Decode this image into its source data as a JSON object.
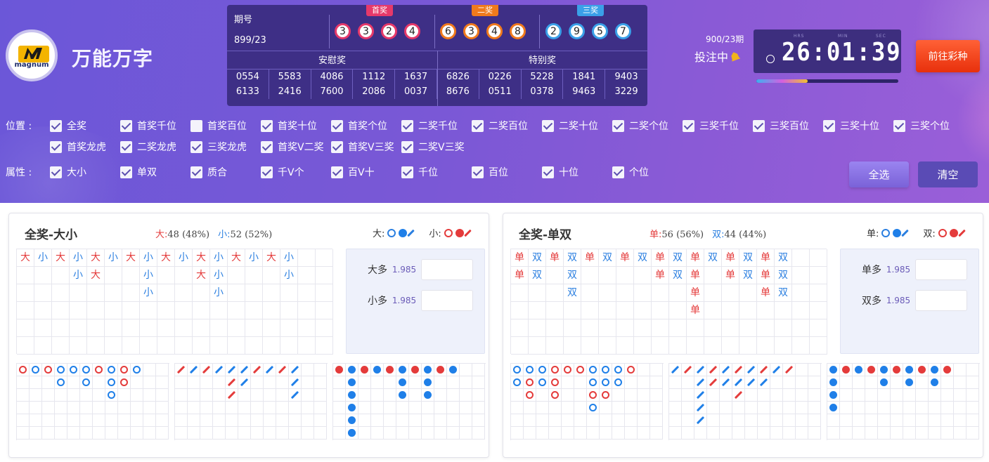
{
  "brand": {
    "logo_text": "magnum",
    "name": "万能万字"
  },
  "results": {
    "period_label": "期号",
    "period": "899/23",
    "prize1": {
      "label": "首奖",
      "numbers": [
        "3",
        "3",
        "2",
        "4"
      ]
    },
    "prize2": {
      "label": "二奖",
      "numbers": [
        "6",
        "3",
        "4",
        "8"
      ]
    },
    "prize3": {
      "label": "三奖",
      "numbers": [
        "2",
        "9",
        "5",
        "7"
      ]
    },
    "consolation_label": "安慰奖",
    "special_label": "特别奖",
    "rows": [
      [
        "0554",
        "5583",
        "4086",
        "1112",
        "1637",
        "6826",
        "0226",
        "5228",
        "1841",
        "9403"
      ],
      [
        "6133",
        "2416",
        "7600",
        "2086",
        "0037",
        "8676",
        "0511",
        "0378",
        "9463",
        "3229"
      ]
    ]
  },
  "countdown": {
    "next_period": "900/23期",
    "status": "投注中",
    "units": [
      "HRS",
      "MIN",
      "SEC"
    ],
    "time": "26:01:39",
    "progress": 0.36
  },
  "goto_button": "前往彩种",
  "filters": {
    "position_label": "位置 :",
    "positions": [
      {
        "label": "全奖",
        "checked": true
      },
      {
        "label": "首奖千位",
        "checked": true
      },
      {
        "label": "首奖百位",
        "checked": false
      },
      {
        "label": "首奖十位",
        "checked": true
      },
      {
        "label": "首奖个位",
        "checked": true
      },
      {
        "label": "二奖千位",
        "checked": true
      },
      {
        "label": "二奖百位",
        "checked": true
      },
      {
        "label": "二奖十位",
        "checked": true
      },
      {
        "label": "二奖个位",
        "checked": true
      },
      {
        "label": "三奖千位",
        "checked": true
      },
      {
        "label": "三奖百位",
        "checked": true
      },
      {
        "label": "三奖十位",
        "checked": true
      },
      {
        "label": "三奖个位",
        "checked": true
      },
      {
        "label": "首奖龙虎",
        "checked": true
      },
      {
        "label": "二奖龙虎",
        "checked": true
      },
      {
        "label": "三奖龙虎",
        "checked": true
      },
      {
        "label": "首奖V二奖",
        "checked": true
      },
      {
        "label": "首奖V三奖",
        "checked": true
      },
      {
        "label": "二奖V三奖",
        "checked": true
      }
    ],
    "attr_label": "属性 :",
    "attrs": [
      {
        "label": "大小",
        "checked": true
      },
      {
        "label": "单双",
        "checked": true
      },
      {
        "label": "质合",
        "checked": true
      },
      {
        "label": "千V个",
        "checked": true
      },
      {
        "label": "百V十",
        "checked": true
      },
      {
        "label": "千位",
        "checked": true
      },
      {
        "label": "百位",
        "checked": true
      },
      {
        "label": "十位",
        "checked": true
      },
      {
        "label": "个位",
        "checked": true
      }
    ],
    "select_all": "全选",
    "clear": "清空"
  },
  "colors": {
    "red": "#e43b3b",
    "blue": "#2b7fe0",
    "accent": "#6b57d8",
    "button": "#e8300c"
  },
  "panels": [
    {
      "title": "全奖-大小",
      "stat_a_label": "大:",
      "stat_a_value": "48 (48%)",
      "stat_b_label": "小:",
      "stat_b_value": "52 (52%)",
      "legend_a": "大:",
      "legend_b": "小:",
      "odds": [
        {
          "label": "大多",
          "value": "1.985"
        },
        {
          "label": "小多",
          "value": "1.985"
        }
      ],
      "bigroad": [
        [
          [
            "大",
            "r"
          ]
        ],
        [
          [
            "小",
            "b"
          ]
        ],
        [
          [
            "大",
            "r"
          ]
        ],
        [
          [
            "小",
            "b"
          ],
          [
            "小",
            "b"
          ]
        ],
        [
          [
            "大",
            "r"
          ],
          [
            "大",
            "r"
          ]
        ],
        [
          [
            "小",
            "b"
          ]
        ],
        [
          [
            "大",
            "r"
          ]
        ],
        [
          [
            "小",
            "b"
          ],
          [
            "小",
            "b"
          ],
          [
            "小",
            "b"
          ]
        ],
        [
          [
            "大",
            "r"
          ]
        ],
        [
          [
            "小",
            "b"
          ]
        ],
        [
          [
            "大",
            "r"
          ],
          [
            "大",
            "r"
          ]
        ],
        [
          [
            "小",
            "b"
          ],
          [
            "小",
            "b"
          ],
          [
            "小",
            "b"
          ]
        ],
        [
          [
            "大",
            "r"
          ]
        ],
        [
          [
            "小",
            "b"
          ]
        ],
        [
          [
            "大",
            "r"
          ]
        ],
        [
          [
            "小",
            "b"
          ],
          [
            "小",
            "b"
          ]
        ]
      ],
      "small1": [
        [
          "ring-r"
        ],
        [
          "ring-b"
        ],
        [
          "ring-r"
        ],
        [
          "ring-b",
          "ring-b"
        ],
        [
          "ring-b"
        ],
        [
          "ring-b",
          "ring-b"
        ],
        [
          "ring-r"
        ],
        [
          "ring-b",
          "ring-b",
          "ring-b"
        ],
        [
          "ring-r",
          "ring-r"
        ],
        [
          "ring-b"
        ]
      ],
      "small2": [
        [
          "sl-r"
        ],
        [
          "sl-b"
        ],
        [
          "sl-r"
        ],
        [
          "sl-b"
        ],
        [
          "sl-b",
          "sl-r",
          "sl-r"
        ],
        [
          "sl-b",
          "sl-b"
        ],
        [
          "sl-r"
        ],
        [
          "sl-b"
        ],
        [
          "sl-r"
        ],
        [
          "sl-b",
          "sl-b",
          "sl-b"
        ]
      ],
      "small3": [
        [
          "dot-r"
        ],
        [
          "dot-b",
          "dot-b",
          "dot-b",
          "dot-b",
          "dot-b",
          "dot-b"
        ],
        [
          "dot-r"
        ],
        [
          "dot-b"
        ],
        [
          "dot-r"
        ],
        [
          "dot-b",
          "dot-b",
          "dot-b"
        ],
        [
          "dot-r"
        ],
        [
          "dot-b",
          "dot-b",
          "dot-b"
        ],
        [
          "dot-r"
        ],
        [
          "dot-b"
        ]
      ],
      "small3_extra": [
        [
          1,
          5
        ]
      ]
    },
    {
      "title": "全奖-单双",
      "stat_a_label": "单:",
      "stat_a_value": "56 (56%)",
      "stat_b_label": "双:",
      "stat_b_value": "44 (44%)",
      "legend_a": "单:",
      "legend_b": "双:",
      "odds": [
        {
          "label": "单多",
          "value": "1.985"
        },
        {
          "label": "双多",
          "value": "1.985"
        }
      ],
      "bigroad": [
        [
          [
            "单",
            "r"
          ],
          [
            "单",
            "r"
          ]
        ],
        [
          [
            "双",
            "b"
          ],
          [
            "双",
            "b"
          ]
        ],
        [
          [
            "单",
            "r"
          ]
        ],
        [
          [
            "双",
            "b"
          ],
          [
            "双",
            "b"
          ],
          [
            "双",
            "b"
          ]
        ],
        [
          [
            "单",
            "r"
          ]
        ],
        [
          [
            "双",
            "b"
          ]
        ],
        [
          [
            "单",
            "r"
          ]
        ],
        [
          [
            "双",
            "b"
          ]
        ],
        [
          [
            "单",
            "r"
          ],
          [
            "单",
            "r"
          ]
        ],
        [
          [
            "双",
            "b"
          ],
          [
            "双",
            "b"
          ]
        ],
        [
          [
            "单",
            "r"
          ],
          [
            "单",
            "r"
          ],
          [
            "单",
            "r"
          ],
          [
            "单",
            "r"
          ]
        ],
        [
          [
            "双",
            "b"
          ]
        ],
        [
          [
            "单",
            "r"
          ],
          [
            "单",
            "r"
          ]
        ],
        [
          [
            "双",
            "b"
          ],
          [
            "双",
            "b"
          ]
        ],
        [
          [
            "单",
            "r"
          ],
          [
            "单",
            "r"
          ],
          [
            "单",
            "r"
          ]
        ],
        [
          [
            "双",
            "b"
          ],
          [
            "双",
            "b"
          ],
          [
            "双",
            "b"
          ]
        ]
      ],
      "small1": [
        [
          "ring-b",
          "ring-b"
        ],
        [
          "ring-b",
          "ring-r",
          "ring-r"
        ],
        [
          "ring-b",
          "ring-b"
        ],
        [
          "ring-r",
          "ring-r",
          "ring-r"
        ],
        [
          "ring-r"
        ],
        [
          "ring-r"
        ],
        [
          "ring-b",
          "ring-b",
          "ring-r",
          "ring-b"
        ],
        [
          "ring-b",
          "ring-b",
          "ring-r"
        ],
        [
          "ring-b",
          "ring-b"
        ],
        [
          "ring-r"
        ]
      ],
      "small2": [
        [
          "sl-b"
        ],
        [
          "sl-r"
        ],
        [
          "sl-b",
          "sl-b",
          "sl-b",
          "sl-b",
          "sl-b"
        ],
        [
          "sl-r",
          "sl-r"
        ],
        [
          "sl-b",
          "sl-b"
        ],
        [
          "sl-r",
          "sl-b",
          "sl-r"
        ],
        [
          "sl-b",
          "sl-b"
        ],
        [
          "sl-r",
          "sl-b"
        ],
        [
          "sl-b"
        ],
        [
          "sl-r"
        ]
      ],
      "small3": [
        [
          "dot-b",
          "dot-b",
          "dot-b",
          "dot-b"
        ],
        [
          "dot-r"
        ],
        [
          "dot-b"
        ],
        [
          "dot-r"
        ],
        [
          "dot-b",
          "dot-b"
        ],
        [
          "dot-r"
        ],
        [
          "dot-b",
          "dot-b"
        ],
        [
          "dot-r"
        ],
        [
          "dot-b",
          "dot-b"
        ],
        [
          "dot-r"
        ]
      ],
      "small3_extra": []
    }
  ]
}
